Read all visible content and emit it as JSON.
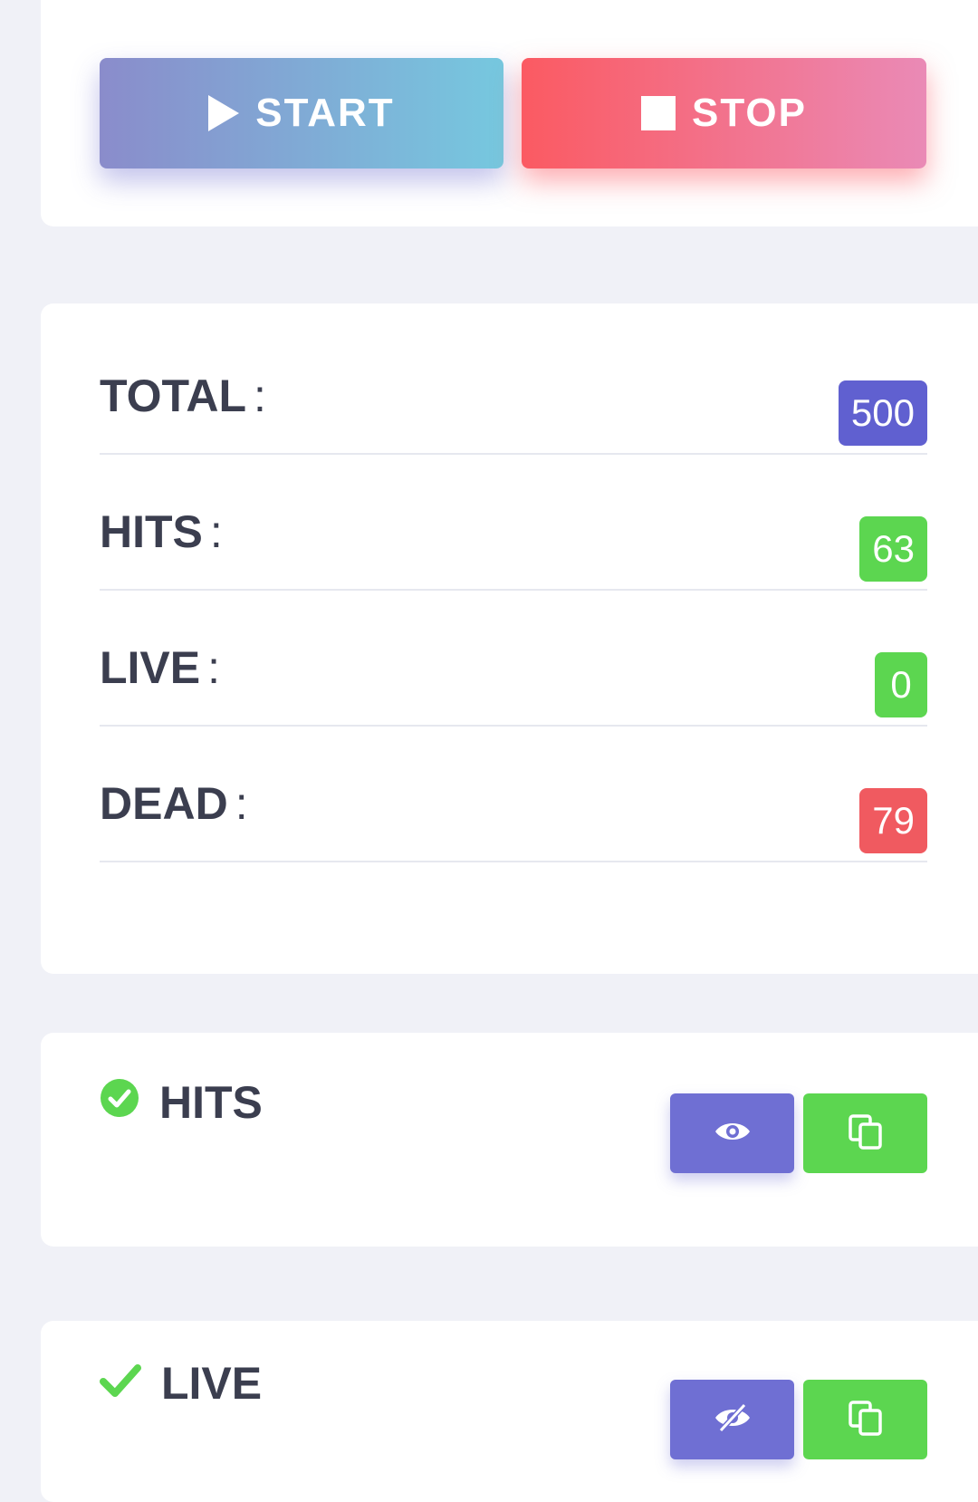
{
  "controls": {
    "start_label": "START",
    "stop_label": "STOP"
  },
  "stats": [
    {
      "label": "TOTAL",
      "sep": ":",
      "value": "500",
      "color": "#6060d0"
    },
    {
      "label": "HITS",
      "sep": ":",
      "value": "63",
      "color": "#5cd650"
    },
    {
      "label": "LIVE",
      "sep": ":",
      "value": "0",
      "color": "#5cd650"
    },
    {
      "label": "DEAD",
      "sep": ":",
      "value": "79",
      "color": "#f05a60"
    }
  ],
  "sections": {
    "hits": {
      "title": "HITS",
      "icon": "check-circle-icon",
      "view_icon": "eye-icon",
      "copy_icon": "copy-icon"
    },
    "live": {
      "title": "LIVE",
      "icon": "check-icon",
      "view_icon": "eye-slash-icon",
      "copy_icon": "copy-icon"
    }
  },
  "colors": {
    "accent_purple": "#6f6fd3",
    "success_green": "#5cd650",
    "danger_red": "#f05a60",
    "text_dark": "#3b3e4f",
    "background": "#f0f1f7"
  }
}
